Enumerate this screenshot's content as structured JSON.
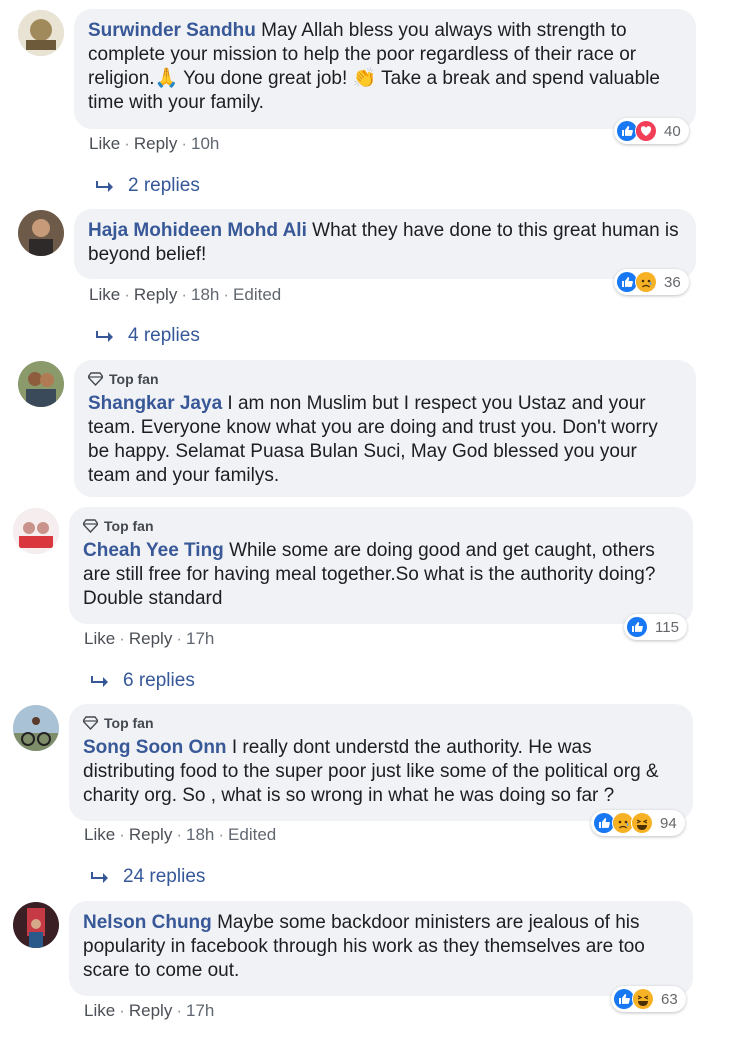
{
  "colors": {
    "author": "#385898",
    "bubble": "#f0f2f5",
    "like_blue": "#1877f2",
    "love_red": "#f33e58",
    "haha_yellow": "#f7b125"
  },
  "labels": {
    "like": "Like",
    "reply": "Reply",
    "top_fan": "Top fan",
    "dot": "·"
  },
  "comments": [
    {
      "author": "Surwinder Sandhu",
      "text": "May Allah bless you always with strength to complete your mission to help the poor regardless of their race or religion.🙏 You done great job! 👏 Take a break and spend valuable time with your family.",
      "time": "10h",
      "edited": "",
      "reactions": [
        "like-icon",
        "love-icon"
      ],
      "reaction_count": "40",
      "replies": "2 replies"
    },
    {
      "author": "Haja Mohideen Mohd Ali",
      "text": "What they have done to this great human is beyond belief!",
      "time": "18h",
      "edited": "Edited",
      "reactions": [
        "like-icon",
        "sad-icon"
      ],
      "reaction_count": "36",
      "replies": "4 replies"
    },
    {
      "top_fan": true,
      "author": "Shangkar Jaya",
      "text": "I am non Muslim but I respect you Ustaz and your team. Everyone know what you are doing and trust you. Don't worry be happy. Selamat Puasa Bulan Suci, May God blessed you your team and your familys."
    },
    {
      "top_fan": true,
      "author": "Cheah Yee Ting",
      "text": "While some are doing good and get caught, others are still free for having meal together.So what is the authority doing? Double standard",
      "time": "17h",
      "edited": "",
      "reactions": [
        "like-icon"
      ],
      "reaction_count": "115",
      "replies": "6 replies"
    },
    {
      "top_fan": true,
      "author": "Song Soon Onn",
      "text": "I really dont understd the authority. He was distributing food to the super poor just like some of the political org & charity org. So , what is so wrong in what he was doing so far ?",
      "time": "18h",
      "edited": "Edited",
      "reactions": [
        "like-icon",
        "sad-icon",
        "haha-icon"
      ],
      "reaction_count": "94",
      "replies": "24 replies"
    },
    {
      "author": "Nelson Chung",
      "text": "Maybe some backdoor ministers are jealous of his popularity in facebook through his work as they themselves are too scare to come out.",
      "time": "17h",
      "edited": "",
      "reactions": [
        "like-icon",
        "haha-icon"
      ],
      "reaction_count": "63"
    }
  ]
}
